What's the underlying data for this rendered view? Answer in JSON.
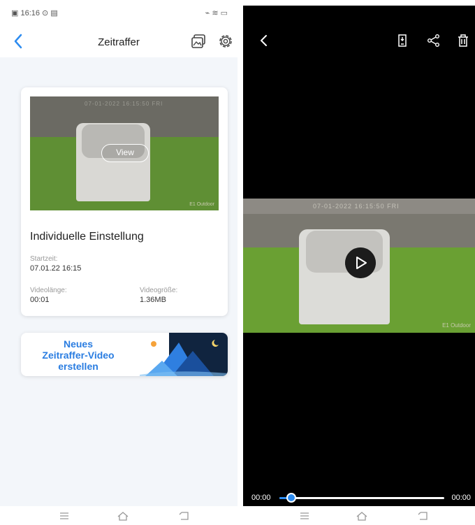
{
  "status_bar": {
    "time": "16:16",
    "left_icons": "⊙ ▤",
    "right_icons": "⌁ ≋ ▭"
  },
  "header": {
    "title": "Zeitraffer",
    "icons": [
      "back-arrow-icon",
      "gallery-icon",
      "settings-gear-icon"
    ]
  },
  "video_card": {
    "view_label": "View",
    "thumbnail_timestamp": "07-01-2022 16:15:50 FRI",
    "thumbnail_watermark": "E1 Outdoor",
    "title": "Individuelle Einstellung",
    "start_label": "Startzeit:",
    "start_value": "07.01.22 16:15",
    "length_label": "Videolänge:",
    "length_value": "00:01",
    "size_label": "Videogröße:",
    "size_value": "1.36MB"
  },
  "banner": {
    "line1": "Neues",
    "line2": "Zeitraffer-Video",
    "line3": "erstellen"
  },
  "player": {
    "icons": [
      "back-arrow-icon",
      "save-to-phone-icon",
      "share-icon",
      "trash-icon",
      "play-icon"
    ],
    "video_timestamp": "07-01-2022 16:15:50 FRI",
    "video_watermark": "E1 Outdoor",
    "time_start": "00:00",
    "time_end": "00:00",
    "progress": 0.05
  },
  "nav_bar": {
    "icons": [
      "menu-icon",
      "home-icon",
      "back-icon"
    ]
  },
  "colors": {
    "accent": "#2d8cf0",
    "banner_text": "#2a7de1",
    "page_bg": "#f3f6fa",
    "player_bg": "#000000"
  }
}
